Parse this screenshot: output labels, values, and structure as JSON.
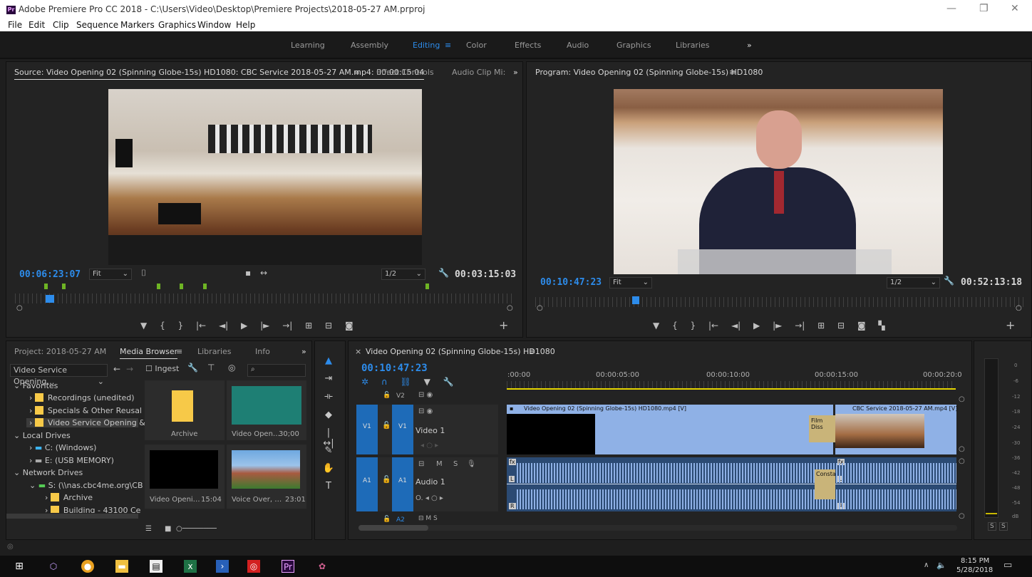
{
  "window": {
    "title": "Adobe Premiere Pro CC 2018 - C:\\Users\\Video\\Desktop\\Premiere Projects\\2018-05-27 AM.prproj",
    "app_badge": "Pr",
    "controls": [
      "—",
      "❐",
      "✕"
    ]
  },
  "menu": [
    "File",
    "Edit",
    "Clip",
    "Sequence",
    "Markers",
    "Graphics",
    "Window",
    "Help"
  ],
  "workspaces": [
    "Learning",
    "Assembly",
    "Editing",
    "Color",
    "Effects",
    "Audio",
    "Graphics",
    "Libraries"
  ],
  "workspace_active": "Editing",
  "workspace_more": "»",
  "source": {
    "tab": "Source: Video Opening 02 (Spinning Globe-15s) HD1080: CBC Service 2018-05-27 AM.mp4: 00:00:15:04",
    "tab_menu": "≡",
    "tabs": [
      "Effect Controls",
      "Audio Clip Mi:"
    ],
    "more": "»",
    "timecode": "00:06:23:07",
    "zoom": "Fit",
    "resolution": "1/2",
    "duration": "00:03:15:03"
  },
  "program": {
    "tab": "Program: Video Opening 02 (Spinning Globe-15s) HD1080",
    "tab_menu": "≡",
    "timecode": "00:10:47:23",
    "zoom": "Fit",
    "resolution": "1/2",
    "duration": "00:52:13:18"
  },
  "project": {
    "tabs": [
      "Project: 2018-05-27 AM",
      "Media Browser",
      "Libraries",
      "Info"
    ],
    "active_tab": "Media Browser",
    "tab_menu": "≡",
    "more": "»",
    "location": "Video Service Opening…",
    "ingest_label": "Ingest",
    "tree": [
      {
        "label": "Favorites",
        "depth": 0,
        "kind": "group"
      },
      {
        "label": "Recordings (unedited)",
        "depth": 1,
        "kind": "folder"
      },
      {
        "label": "Specials & Other Reusal",
        "depth": 1,
        "kind": "folder"
      },
      {
        "label": "Video Service Opening &",
        "depth": 1,
        "kind": "folder",
        "selected": true
      },
      {
        "label": "Local Drives",
        "depth": 0,
        "kind": "group"
      },
      {
        "label": "C: (Windows)",
        "depth": 1,
        "kind": "drive"
      },
      {
        "label": "E: (USB MEMORY)",
        "depth": 1,
        "kind": "drive"
      },
      {
        "label": "Network Drives",
        "depth": 0,
        "kind": "group"
      },
      {
        "label": "S: (\\\\nas.cbc4me.org\\CB",
        "depth": 1,
        "kind": "drive"
      },
      {
        "label": "Archive",
        "depth": 2,
        "kind": "folder"
      },
      {
        "label": "Building - 43100 Ce",
        "depth": 2,
        "kind": "folder"
      }
    ],
    "items": [
      {
        "name": "Archive",
        "duration": ""
      },
      {
        "name": "Video Open…",
        "duration": "30;00"
      },
      {
        "name": "Video Openi…",
        "duration": "15:04"
      },
      {
        "name": "Voice Over, …",
        "duration": "23:01"
      }
    ]
  },
  "timeline": {
    "tab": "Video Opening 02 (Spinning Globe-15s) HD1080",
    "tab_close": "×",
    "tab_menu": "≡",
    "timecode": "00:10:47:23",
    "ruler": [
      ":00:00",
      "00:00:05:00",
      "00:00:10:00",
      "00:00:15:00",
      "00:00:20:0"
    ],
    "tracks": {
      "v2": "V2",
      "v1": "V1",
      "v1_name": "Video 1",
      "a1": "A1",
      "a1_name": "Audio 1",
      "a2": "A2",
      "m": "M",
      "s": "S"
    },
    "clips": {
      "video1": "Video Opening 02 (Spinning Globe-15s) HD1080.mp4 [V]",
      "video2": "CBC Service 2018-05-27 AM.mp4 [V]",
      "transition_v": "Film Diss",
      "transition_a": "Consta",
      "audio_l": "L",
      "audio_r": "R",
      "fx": "fx"
    }
  },
  "meter": {
    "scale": [
      "0",
      "-6",
      "-12",
      "-18",
      "-24",
      "-30",
      "-36",
      "-42",
      "-48",
      "-54",
      "dB"
    ],
    "solo": [
      "S",
      "S"
    ]
  },
  "taskbar": {
    "time": "8:15 PM",
    "date": "5/28/2018"
  },
  "colors": {
    "accent": "#2d8ceb",
    "marker": "#6eb424",
    "clip_video": "#8fb1e6",
    "clip_audio": "#2b4a73",
    "playhead_bar": "#e5d500"
  }
}
